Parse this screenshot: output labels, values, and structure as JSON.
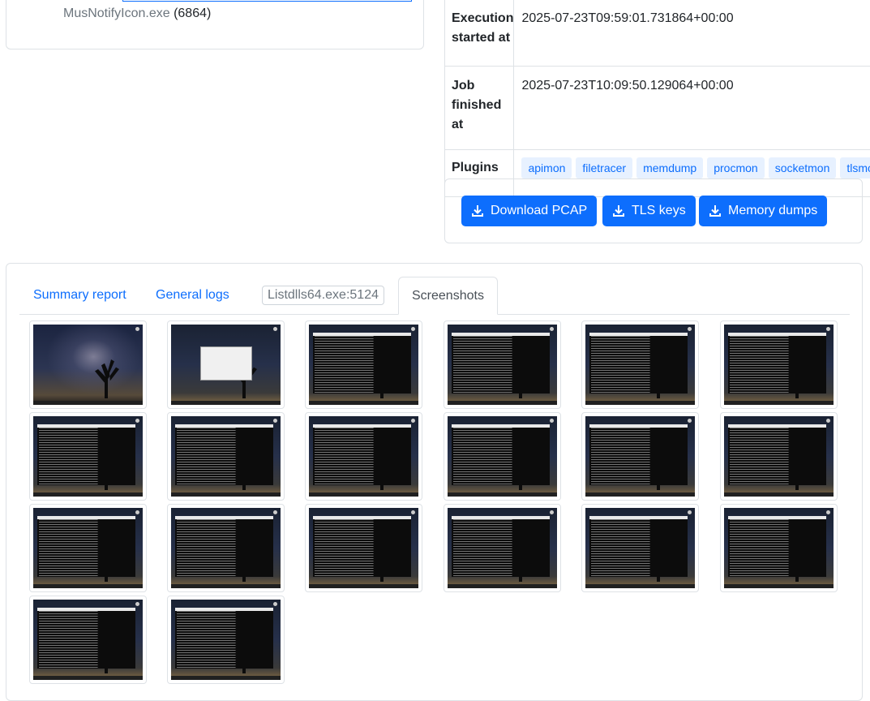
{
  "process_tree": {
    "process_name": "MusNotifyIcon.exe",
    "process_pid": "(6864)"
  },
  "info_table": {
    "rows": [
      {
        "key": "Execution started at",
        "value": "2025-07-23T09:59:01.731864+00:00"
      },
      {
        "key": "Job finished at",
        "value": "2025-07-23T10:09:50.129064+00:00"
      }
    ],
    "plugins_label": "Plugins",
    "plugins": [
      "apimon",
      "filetracer",
      "memdump",
      "procmon",
      "socketmon",
      "tlsmon"
    ]
  },
  "downloads": {
    "buttons": [
      "Download PCAP",
      "TLS keys",
      "Memory dumps"
    ]
  },
  "tabs": {
    "summary": "Summary report",
    "general_logs": "General logs",
    "process_pill": "Listdlls64.exe:5124",
    "screenshots": "Screenshots",
    "active": "Screenshots"
  },
  "screenshots": {
    "count": 20,
    "kinds": [
      "desktop",
      "dialog",
      "terminal",
      "terminal",
      "terminal",
      "terminal",
      "terminal",
      "terminal",
      "terminal",
      "terminal",
      "terminal",
      "terminal",
      "terminal",
      "terminal",
      "terminal",
      "terminal",
      "terminal",
      "terminal",
      "terminal",
      "terminal"
    ]
  },
  "colors": {
    "primary": "#0d6efd",
    "badge_bg": "#e7f1ff",
    "border": "#dee2e6"
  }
}
